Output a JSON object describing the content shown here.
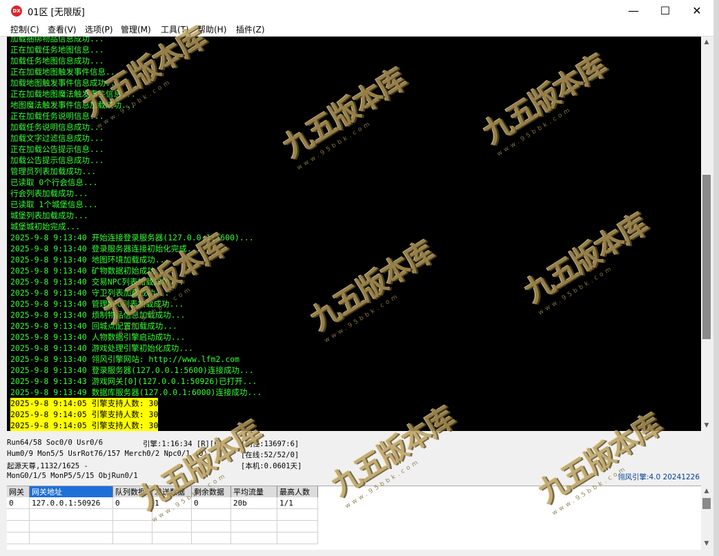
{
  "window": {
    "icon_label": "DX",
    "title": "01区 [无限版]",
    "min_glyph": "—",
    "max_glyph": "☐",
    "close_glyph": "✕"
  },
  "menu": [
    "控制(C)",
    "查看(V)",
    "选项(P)",
    "管理(M)",
    "工具(T)",
    "帮助(H)",
    "插件(Z)"
  ],
  "console": {
    "lines": [
      "加载捆绑物品信息成功...",
      "正在加载任务地图信息...",
      "加载任务地图信息成功...",
      "正在加载地图触发事件信息...",
      "加载地图触发事件信息成功...",
      "正在加载地图魔法触发事件信息...",
      "地图魔法触发事件信息加载成功...",
      "正在加载任务说明信息...",
      "加载任务说明信息成功...",
      "加载文字过滤信息成功...",
      "正在加载公告提示信息...",
      "加载公告提示信息成功...",
      "管理员列表加载成功...",
      "已读取 0个行会信息...",
      "行会列表加载成功...",
      "已读取 1个城堡信息...",
      "城堡列表加载成功...",
      "城堡城初始完成...",
      "2025-9-8 9:13:40 开始连接登录服务器(127.0.0.1:5600)...",
      "2025-9-8 9:13:40 登录服务器连接初始化完成...",
      "2025-9-8 9:13:40 地图环境加载成功...",
      "2025-9-8 9:13:40 矿物数据初始成功...",
      "2025-9-8 9:13:40 交易NPC列表加载成功...",
      "2025-9-8 9:13:40 守卫列表加载成功...",
      "2025-9-8 9:13:40 管理NPC列表加载成功...",
      "2025-9-8 9:13:40 烦制物品信息加载成功...",
      "2025-9-8 9:13:40 回城点配置加载成功...",
      "2025-9-8 9:13:40 人物数据引擎启动成功...",
      "2025-9-8 9:13:40 游戏处理引擎初始化成功...",
      "2025-9-8 9:13:40 翎风引擎网站: http://www.lfm2.com",
      "2025-9-8 9:13:40 登录服务器(127.0.0.1:5600)连接成功...",
      "2025-9-8 9:13:43 游戏网关[0](127.0.0.1:50926)已打开...",
      "2025-9-8 9:13:49 数据库服务器(127.0.0.1:6000)连接成功..."
    ],
    "highlight_lines": [
      "2025-9-8 9:14:05 引擎支持人数: 30",
      "2025-9-8 9:14:05 引擎支持人数: 30",
      "2025-9-8 9:14:05 引擎支持人数: 30"
    ]
  },
  "status": {
    "run": "Run64/58 Soc0/0 Usr0/6",
    "engine_time": "引擎:1:16:34 [R][F]",
    "refresh": "[刷怪:13697:6]",
    "hum": "Hum0/9 Mon5/5 UsrRot76/157 Merch0/2 Npc0/1 (0)",
    "online": "[在线:52/52/0]",
    "origin": "起源天尊,1132/1625 -",
    "local": "[本机:0.0601天]",
    "mon": "MonG0/1/5 MonP5/5/15 ObjRun0/1",
    "engine_version": "翎风引擎:4.0 20241226"
  },
  "gateway_table": {
    "headers": [
      "网关",
      "网关地址",
      "队列数据",
      "发送数据",
      "剩余数据",
      "平均流量",
      "最高人数"
    ],
    "rows": [
      [
        "0",
        "127.0.0.1:50926",
        "0",
        "1",
        "0",
        "20b",
        "1/1"
      ]
    ]
  },
  "scroll": {
    "up": "▲",
    "down": "▼"
  },
  "watermark": {
    "main": "九五版本库",
    "sub": "www.95bbk.com"
  },
  "colors": {
    "console_bg": "#000000",
    "console_text": "#33ff33",
    "highlight_bg": "#ffff00",
    "selected_header": "#1e6fd8"
  }
}
